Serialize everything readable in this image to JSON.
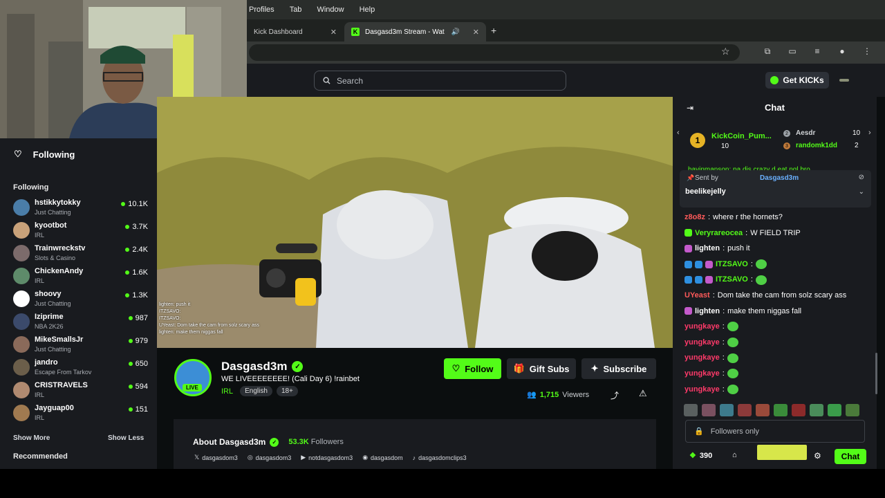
{
  "menubar": [
    "Profiles",
    "Tab",
    "Window",
    "Help"
  ],
  "tabs": [
    {
      "title": "Kick Dashboard",
      "active": false
    },
    {
      "title": "Dasgasd3m Stream - Wat",
      "active": true
    }
  ],
  "search": {
    "placeholder": "Search"
  },
  "get_kicks": "Get KICKs",
  "sidebar": {
    "following_header": "Following",
    "following_title": "Following",
    "channels": [
      {
        "name": "hstikkytokky",
        "category": "Just Chatting",
        "viewers": "10.1K"
      },
      {
        "name": "kyootbot",
        "category": "IRL",
        "viewers": "3.7K"
      },
      {
        "name": "Trainwreckstv",
        "category": "Slots & Casino",
        "viewers": "2.4K"
      },
      {
        "name": "ChickenAndy",
        "category": "IRL",
        "viewers": "1.6K"
      },
      {
        "name": "shoovy",
        "category": "Just Chatting",
        "viewers": "1.3K"
      },
      {
        "name": "Iziprime",
        "category": "NBA 2K26",
        "viewers": "987"
      },
      {
        "name": "MikeSmallsJr",
        "category": "Just Chatting",
        "viewers": "979"
      },
      {
        "name": "jandro",
        "category": "Escape From Tarkov",
        "viewers": "650"
      },
      {
        "name": "CRISTRAVELS",
        "category": "IRL",
        "viewers": "594"
      },
      {
        "name": "Jayguap00",
        "category": "IRL",
        "viewers": "151"
      }
    ],
    "show_more": "Show More",
    "show_less": "Show Less",
    "recommended": "Recommended"
  },
  "video_chat_overlay": [
    "lighten: push it",
    "ITZSAVO:",
    "ITZSAVO:",
    "UYeast: Dom take the cam from solz scary ass",
    "lighten: make them niggas fall"
  ],
  "stream": {
    "streamer": "Dasgasd3m",
    "live_label": "LIVE",
    "title": "WE LIVEEEEEEEE! (Cali Day 6) !rainbet",
    "category": "IRL",
    "tags": [
      "English",
      "18+"
    ],
    "follow": "Follow",
    "gift_subs": "Gift Subs",
    "subscribe": "Subscribe",
    "viewers": "1,715",
    "viewers_label": "Viewers"
  },
  "about": {
    "title": "About Dasgasd3m",
    "followers": "53.3K",
    "followers_label": "Followers",
    "socials": [
      "dasgasdom3",
      "dasgasdom3",
      "notdasgasdom3",
      "dasgasdom",
      "dasgasdomclips3"
    ]
  },
  "chat": {
    "title": "Chat",
    "leaderboard": [
      {
        "rank": "1",
        "name": "KickCoin_Pum...",
        "value": "10"
      },
      {
        "rank": "2",
        "name": "Aesdr",
        "value": "10"
      },
      {
        "rank": "3",
        "name": "randomk1dd",
        "value": "2"
      }
    ],
    "cut_message": "havinmanson: pa dis crazy d eat ngl bro",
    "pinned": {
      "sent_by": "Sent by",
      "sender": "Dasgasd3m",
      "user": "beelikejelly"
    },
    "messages": [
      {
        "user": "z8o8z",
        "color": "#ff5a5a",
        "text": "where r the hornets?",
        "emote": false
      },
      {
        "user": "Veryrareocea",
        "color": "#53fc18",
        "text": "W FIELD TRIP",
        "emote": false
      },
      {
        "user": "lighten",
        "color": "#ffffff",
        "text": "push it",
        "emote": false
      },
      {
        "user": "ITZSAVO",
        "color": "#53fc18",
        "text": "",
        "emote": true
      },
      {
        "user": "ITZSAVO",
        "color": "#53fc18",
        "text": "",
        "emote": true
      },
      {
        "user": "UYeast",
        "color": "#ff5a5a",
        "text": "Dom take the cam from solz scary ass",
        "emote": false
      },
      {
        "user": "lighten",
        "color": "#ffffff",
        "text": "make them niggas fall",
        "emote": false
      },
      {
        "user": "yungkaye",
        "color": "#ff3a6a",
        "text": "",
        "emote": true
      },
      {
        "user": "yungkaye",
        "color": "#ff3a6a",
        "text": "",
        "emote": true
      },
      {
        "user": "yungkaye",
        "color": "#ff3a6a",
        "text": "",
        "emote": true
      },
      {
        "user": "yungkaye",
        "color": "#ff3a6a",
        "text": "",
        "emote": true
      },
      {
        "user": "yungkaye",
        "color": "#ff3a6a",
        "text": "",
        "emote": true
      }
    ],
    "input_placeholder": "Followers only",
    "points": "390",
    "chat_button": "Chat"
  },
  "colors": {
    "accent": "#53fc18",
    "bg": "#0b0e0f",
    "panel": "#191b1f"
  }
}
